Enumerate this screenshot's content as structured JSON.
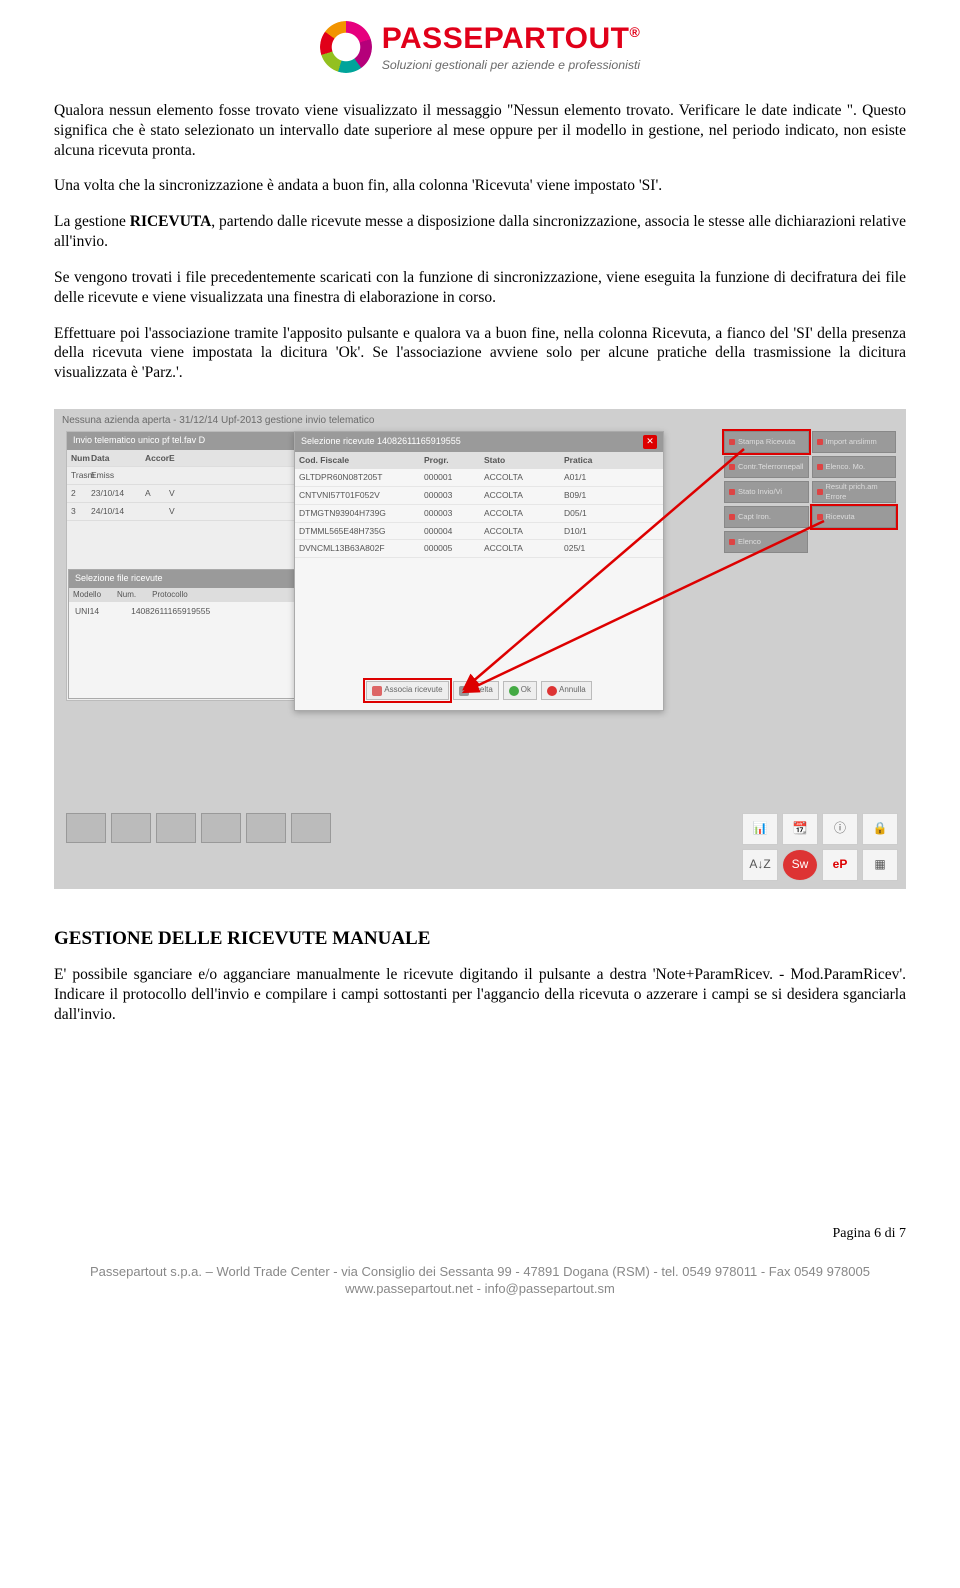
{
  "logo": {
    "title": "PASSEPARTOUT",
    "reg": "®",
    "subtitle": "Soluzioni gestionali per aziende e professionisti"
  },
  "body": {
    "p1": "Qualora nessun elemento fosse trovato viene visualizzato il messaggio \"Nessun elemento trovato. Verificare le date indicate \". Questo significa che è stato selezionato un intervallo date superiore al mese oppure per il modello in gestione, nel periodo indicato, non esiste alcuna ricevuta pronta.",
    "p2": "Una volta che la sincronizzazione è andata a buon fin, alla colonna 'Ricevuta' viene impostato 'SI'.",
    "p3a": "La gestione ",
    "p3b": "RICEVUTA",
    "p3c": ", partendo dalle ricevute messe a disposizione dalla sincronizzazione, associa le stesse alle dichiarazioni relative all'invio.",
    "p4": "Se vengono trovati i file precedentemente scaricati con la funzione di sincronizzazione, viene eseguita la funzione di decifratura dei file delle ricevute e viene visualizzata una finestra di elaborazione in corso.",
    "p5": "Effettuare poi l'associazione tramite l'apposito pulsante e qualora va a buon fine, nella colonna Ricevuta, a fianco del 'SI' della presenza della ricevuta viene impostata la dicitura 'Ok'. Se l'associazione avviene solo per alcune pratiche della trasmissione la dicitura visualizzata è 'Parz.'."
  },
  "screenshot": {
    "window_title": "Nessuna azienda aperta - 31/12/14 Upf-2013 gestione invio telematico",
    "back_panel": {
      "title": "Invio telematico unico pf tel.fav D",
      "headers": [
        "Num",
        "Data",
        "Accor",
        "E"
      ],
      "search": [
        "Trasm",
        "Emiss",
        ""
      ],
      "rows": [
        [
          "2",
          "23/10/14",
          "A",
          "V"
        ],
        [
          "3",
          "24/10/14",
          "",
          "V"
        ]
      ]
    },
    "file_panel": {
      "title": "Selezione file ricevute",
      "headers": [
        "Modello",
        "Num.",
        "Protocollo"
      ],
      "row": [
        "UNI14",
        "",
        "14082611165919555"
      ]
    },
    "modal": {
      "title": "Selezione ricevute 14082611165919555",
      "headers": [
        "Cod. Fiscale",
        "Progr.",
        "Stato",
        "Pratica"
      ],
      "rows": [
        [
          "GLTDPR60N08T205T",
          "000001",
          "ACCOLTA",
          "A01/1"
        ],
        [
          "CNTVNI57T01F052V",
          "000003",
          "ACCOLTA",
          "B09/1"
        ],
        [
          "DTMGTN93904H739G",
          "000003",
          "ACCOLTA",
          "D05/1"
        ],
        [
          "DTMML565E48H735G",
          "000004",
          "ACCOLTA",
          "D10/1"
        ],
        [
          "DVNCML13B63A802F",
          "000005",
          "ACCOLTA",
          "025/1"
        ]
      ],
      "buttons": {
        "associa": "Associa ricevute",
        "scelta": "Scelta",
        "ok": "Ok",
        "annulla": "Annulla"
      }
    },
    "side": {
      "r1a": "Stampa Ricevuta",
      "r1b": "Import anslimm",
      "r2a": "Contr.Telerrornepall",
      "r2b": "Elenco. Mo.",
      "r3a": "Stato Invio/Vi",
      "r3b": "Result prich.am Errore",
      "r4a": "Capt Iron.",
      "r4b": "Ricevuta",
      "r5": "Elenco"
    }
  },
  "section2": {
    "title": "GESTIONE DELLE RICEVUTE MANUALE",
    "p1": "E' possibile sganciare e/o agganciare manualmente le ricevute digitando il pulsante a destra 'Note+ParamRicev. - Mod.ParamRicev'. Indicare il protocollo dell'invio e compilare i campi sottostanti per l'aggancio della ricevuta o azzerare i campi se si desidera sganciarla dall'invio."
  },
  "page_num": "Pagina 6 di 7",
  "footer": {
    "line1": "Passepartout s.p.a. – World Trade Center - via Consiglio dei Sessanta 99 - 47891 Dogana (RSM) - tel. 0549 978011 - Fax 0549 978005",
    "line2": "www.passepartout.net - info@passepartout.sm"
  }
}
